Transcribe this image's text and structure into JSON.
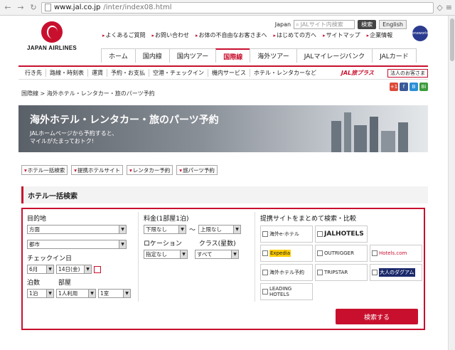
{
  "browser": {
    "url_domain": "www.jal.co.jp",
    "url_path": "/inter/index08.html"
  },
  "header": {
    "brand": "JAPAN AIRLINES",
    "country": "Japan",
    "search_placeholder": "JALサイト内検索",
    "search_button": "検索",
    "english_button": "English",
    "corp_info": "企業情報",
    "oneworld": "oneworld",
    "links": [
      "よくあるご質問",
      "お問い合わせ",
      "お体の不自由なお客さまへ",
      "はじめての方へ",
      "サイトマップ"
    ],
    "nav": [
      "ホーム",
      "国内線",
      "国内ツアー",
      "国際線",
      "海外ツアー",
      "JALマイレージバンク",
      "JALカード"
    ],
    "subnav": [
      "行き先",
      "路線・時刻表",
      "運賃",
      "予約・お支払",
      "空港・チェックイン",
      "機内サービス",
      "ホテル・レンタカーなど"
    ],
    "tabiplus": "JAL旅プラス",
    "sale_label": "法人のお客さま"
  },
  "breadcrumb": "国際線 > 海外ホテル・レンタカー・旅のパーツ予約",
  "social": [
    "+1",
    "f",
    "B",
    "Bi"
  ],
  "banner": {
    "title": "海外ホテル・レンタカー・旅のパーツ予約",
    "sub1": "JALホームページから予約すると、",
    "sub2": "マイルがたまっておトク!"
  },
  "tabs": [
    "ホテル一括検索",
    "提携ホテルサイト",
    "レンタカー予約",
    "旅パーツ予約"
  ],
  "section_title": "ホテル一括検索",
  "form": {
    "dest_label": "目的地",
    "dest_region": "方面",
    "dest_city": "都市",
    "checkin_label": "チェックイン日",
    "month": "6月",
    "day": "14日(金)",
    "nights_label": "泊数",
    "rooms_label": "部屋",
    "nights": "1泊",
    "room_type": "1人利用",
    "rooms": "1室",
    "price_label": "料金(1部屋1泊)",
    "price_min": "下限なし",
    "price_sep": "〜",
    "price_max": "上限なし",
    "location_label": "ロケーション",
    "class_label": "クラス(星数)",
    "location": "指定なし",
    "class": "すべて",
    "partners_label": "提携サイトをまとめて検索・比較",
    "partners": [
      "海外e-ホテル",
      "JALHOTELS",
      "Expedia",
      "OUTRIGGER",
      "Hotels.com",
      "海外ホテル予約",
      "TRIPSTAR",
      "大人のダグアム",
      "LEADING HOTELS"
    ],
    "search_button": "検索する"
  },
  "colors": {
    "brand": "#c8102e"
  }
}
